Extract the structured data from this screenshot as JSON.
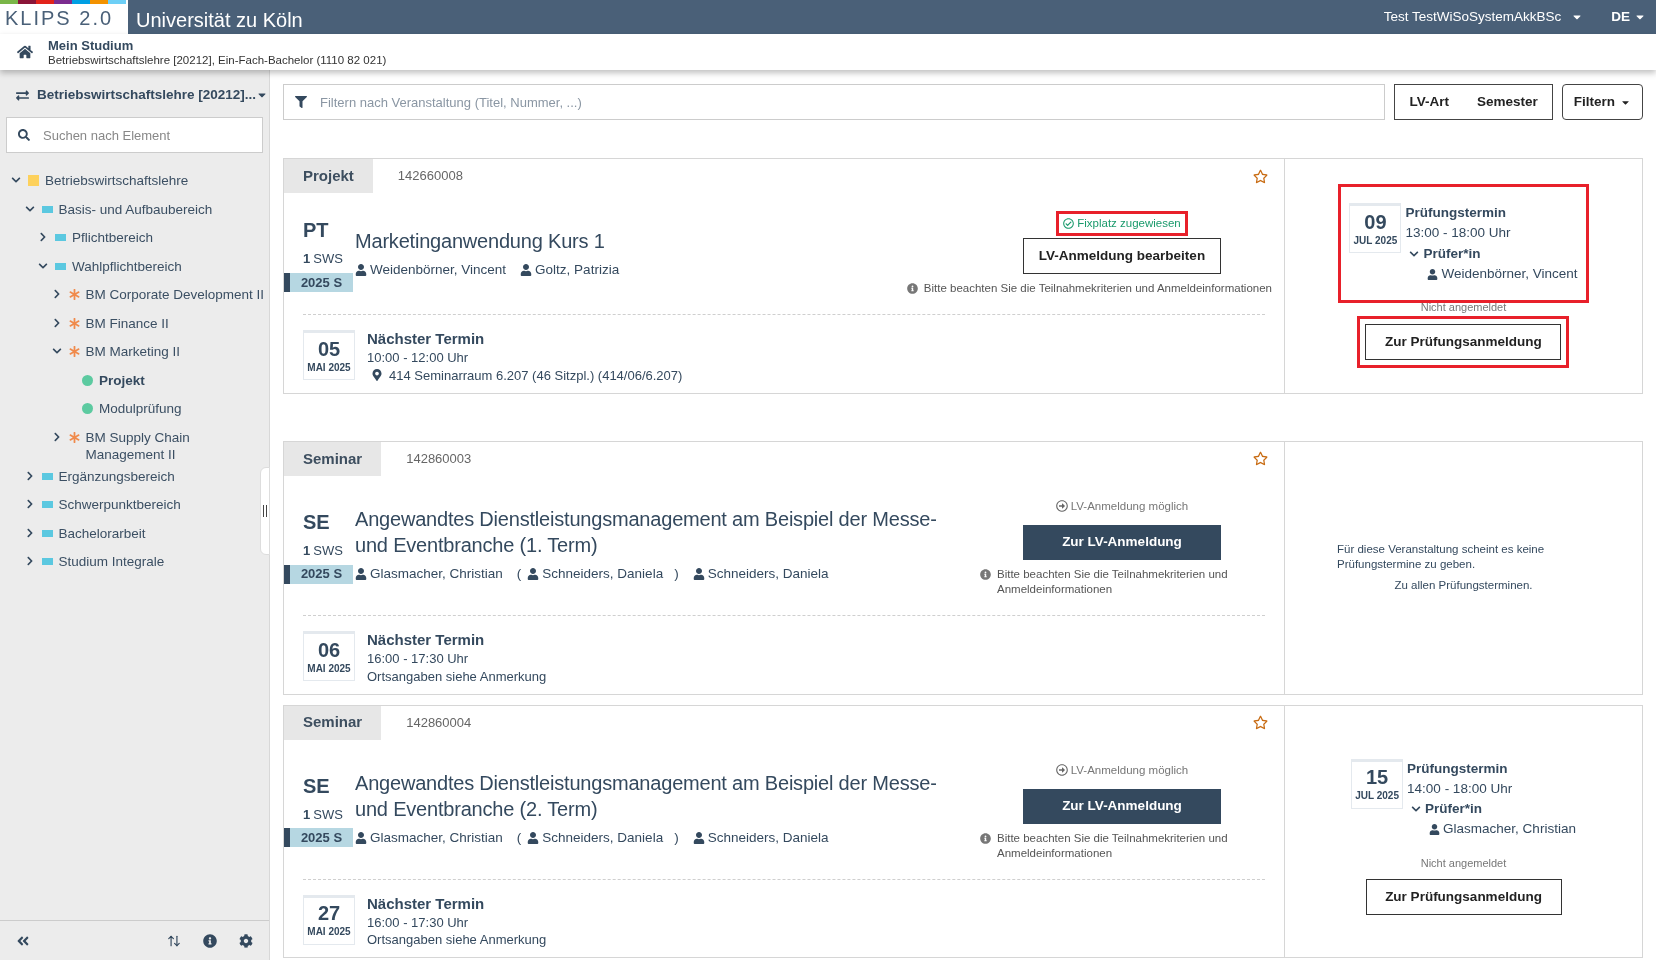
{
  "header": {
    "logo": "KLIPS 2.0",
    "university": "Universität zu Köln",
    "user": "Test TestWiSoSystemAkkBSc",
    "language": "DE"
  },
  "breadcrumb": {
    "title": "Mein Studium",
    "subtitle": "Betriebswirtschaftslehre [20212], Ein-Fach-Bachelor (1110 82 021)"
  },
  "sidebar": {
    "program": "Betriebswirtschaftslehre [20212]...",
    "search_placeholder": "Suchen nach Element",
    "tree": [
      {
        "label": "Betriebswirtschaftslehre",
        "kind": "root",
        "color": "#fdd15c",
        "expanded": true,
        "selected": false,
        "children": [
          {
            "label": "Basis- und Aufbaubereich",
            "kind": "area",
            "color": "#5bc8e0",
            "expanded": true,
            "selected": false,
            "children": [
              {
                "label": "Pflichtbereich",
                "kind": "area",
                "color": "#5bc8e0",
                "expanded": false,
                "selected": false
              },
              {
                "label": "Wahlpflichtbereich",
                "kind": "area",
                "color": "#5bc8e0",
                "expanded": true,
                "selected": false,
                "children": [
                  {
                    "label": "BM Corporate Development II",
                    "kind": "module",
                    "color": "#f08a4b",
                    "expanded": false,
                    "selected": false
                  },
                  {
                    "label": "BM Finance II",
                    "kind": "module",
                    "color": "#f08a4b",
                    "expanded": false,
                    "selected": false
                  },
                  {
                    "label": "BM Marketing II",
                    "kind": "module",
                    "color": "#f08a4b",
                    "expanded": true,
                    "selected": false,
                    "children": [
                      {
                        "label": "Projekt",
                        "kind": "element",
                        "color": "#5ccaa0",
                        "selected": true
                      },
                      {
                        "label": "Modulprüfung",
                        "kind": "element",
                        "color": "#5ccaa0",
                        "selected": false
                      }
                    ]
                  },
                  {
                    "label": "BM Supply Chain Management II",
                    "kind": "module",
                    "color": "#f08a4b",
                    "expanded": false,
                    "selected": false
                  }
                ]
              }
            ]
          },
          {
            "label": "Ergänzungsbereich",
            "kind": "area",
            "color": "#5bc8e0",
            "expanded": false,
            "selected": false
          },
          {
            "label": "Schwerpunktbereich",
            "kind": "area",
            "color": "#5bc8e0",
            "expanded": false,
            "selected": false
          },
          {
            "label": "Bachelorarbeit",
            "kind": "area",
            "color": "#5bc8e0",
            "expanded": false,
            "selected": false
          },
          {
            "label": "Studium Integrale",
            "kind": "area",
            "color": "#5bc8e0",
            "expanded": false,
            "selected": false
          }
        ]
      }
    ]
  },
  "filter": {
    "placeholder": "Filtern nach Veranstaltung (Titel, Nummer, ...)",
    "toggles": [
      "LV-Art",
      "Semester"
    ],
    "menu": "Filtern"
  },
  "courses": [
    {
      "type": "Projekt",
      "number": "142660008",
      "abbr": "PT",
      "sws_value": "1",
      "sws_unit": "SWS",
      "semester": "2025 S",
      "title": "Marketinganwendung Kurs 1",
      "persons": [
        {
          "name": "Weidenbörner, Vincent"
        },
        {
          "name": "Goltz, Patrizia"
        }
      ],
      "action": {
        "kind": "edit",
        "status": "Fixplatz zugewiesen",
        "highlighted": true,
        "button": "LV-Anmeldung bearbeiten",
        "note": "Bitte beachten Sie die Teilnahmekriterien und Anmeldeinformationen"
      },
      "next": {
        "day": "05",
        "month": "MAI 2025",
        "title": "Nächster Termin",
        "time": "10:00 - 12:00 Uhr",
        "place": "414 Seminarraum 6.207 (46 Sitzpl.) (414/06/6.207)",
        "pin": true
      },
      "exam": {
        "kind": "exam",
        "highlighted": true,
        "day": "09",
        "month": "JUL 2025",
        "title": "Prüfungstermin",
        "time": "13:00 - 18:00 Uhr",
        "examiner_label": "Prüfer*in",
        "examiner": "Weidenbörner, Vincent",
        "status": "Nicht angemeldet",
        "button": "Zur Prüfungsanmeldung",
        "button_highlighted": true
      }
    },
    {
      "type": "Seminar",
      "number": "142860003",
      "abbr": "SE",
      "sws_value": "1",
      "sws_unit": "SWS",
      "semester": "2025 S",
      "title": "Angewandtes Dienstleistungsmanagement am Beispiel der Messe- und Eventbranche (1. Term)",
      "persons": [
        {
          "name": "Glasmacher, Christian"
        },
        {
          "name": "Schneiders, Daniela",
          "open": "(",
          "close": ")"
        },
        {
          "name": "Schneiders, Daniela"
        }
      ],
      "action": {
        "kind": "register",
        "status": "LV-Anmeldung möglich",
        "highlighted": false,
        "button": "Zur LV-Anmeldung",
        "note": "Bitte beachten Sie die Teilnahmekriterien und Anmeldeinformationen"
      },
      "next": {
        "day": "06",
        "month": "MAI 2025",
        "title": "Nächster Termin",
        "time": "16:00 - 17:30 Uhr",
        "place": "Ortsangaben siehe Anmerkung",
        "pin": false
      },
      "exam": {
        "kind": "none",
        "text": "Für diese Veranstaltung scheint es keine Prüfungstermine zu geben.",
        "link": "Zu allen Prüfungsterminen."
      }
    },
    {
      "type": "Seminar",
      "number": "142860004",
      "abbr": "SE",
      "sws_value": "1",
      "sws_unit": "SWS",
      "semester": "2025 S",
      "title": "Angewandtes Dienstleistungsmanagement am Beispiel der Messe- und Eventbranche (2. Term)",
      "persons": [
        {
          "name": "Glasmacher, Christian"
        },
        {
          "name": "Schneiders, Daniela",
          "open": "(",
          "close": ")"
        },
        {
          "name": "Schneiders, Daniela"
        }
      ],
      "action": {
        "kind": "register",
        "status": "LV-Anmeldung möglich",
        "highlighted": false,
        "button": "Zur LV-Anmeldung",
        "note": "Bitte beachten Sie die Teilnahmekriterien und Anmeldeinformationen"
      },
      "next": {
        "day": "27",
        "month": "MAI 2025",
        "title": "Nächster Termin",
        "time": "16:00 - 17:30 Uhr",
        "place": "Ortsangaben siehe Anmerkung",
        "pin": false
      },
      "exam": {
        "kind": "exam",
        "highlighted": false,
        "day": "15",
        "month": "JUL 2025",
        "title": "Prüfungstermin",
        "time": "14:00 - 18:00 Uhr",
        "examiner_label": "Prüfer*in",
        "examiner": "Glasmacher, Christian",
        "status": "Nicht angemeldet",
        "button": "Zur Prüfungsanmeldung",
        "button_highlighted": false
      }
    }
  ]
}
